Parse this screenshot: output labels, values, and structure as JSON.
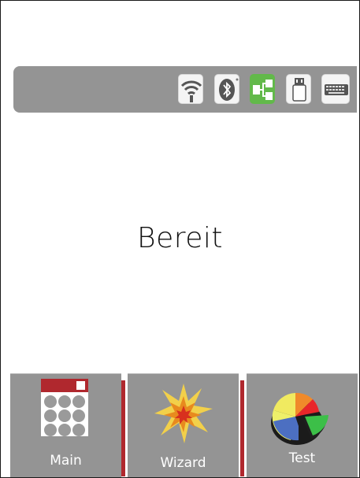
{
  "status": {
    "connections": [
      {
        "name": "wifi",
        "active": false
      },
      {
        "name": "bluetooth",
        "active": false
      },
      {
        "name": "ethernet",
        "active": true
      },
      {
        "name": "usb",
        "active": false
      },
      {
        "name": "keyboard",
        "active": false
      }
    ],
    "active_color": "#62b94a"
  },
  "main": {
    "ready_text": "Bereit"
  },
  "nav": {
    "main_label": "Main",
    "wizard_label": "Wizard",
    "test_label": "Test"
  },
  "colors": {
    "bar": "#949494",
    "accent": "#b0282e"
  }
}
